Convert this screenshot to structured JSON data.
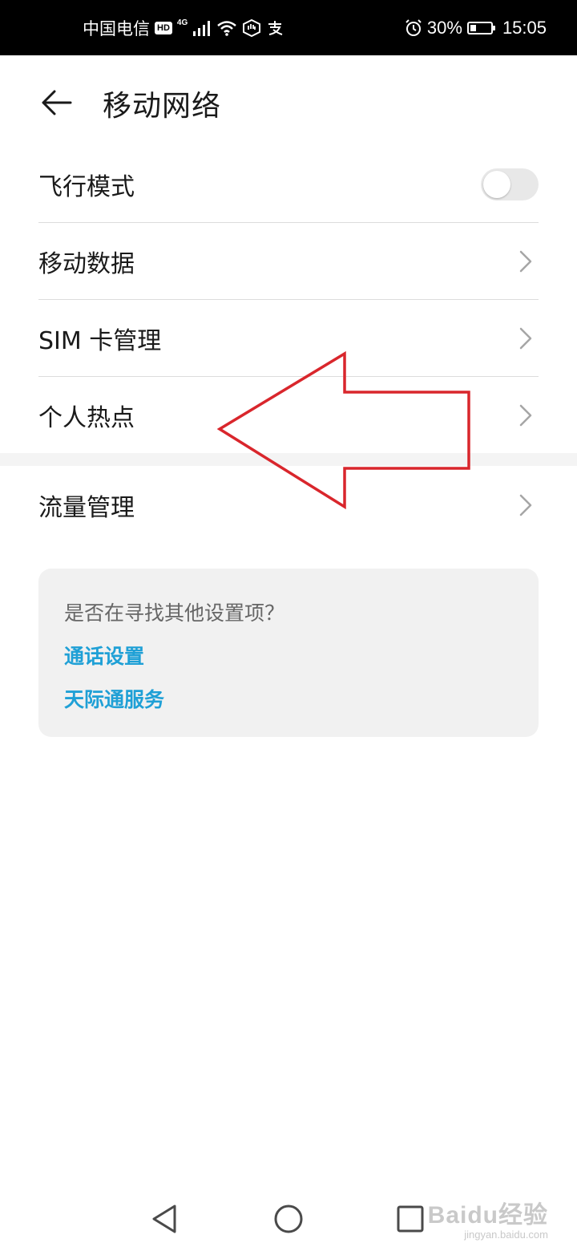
{
  "status_bar": {
    "carrier": "中国电信",
    "hd_badge": "HD",
    "network": "4G",
    "battery_percent": "30%",
    "battery_level": 0.3,
    "time": "15:05",
    "icons": [
      "hd-icon",
      "signal-icon",
      "wifi-icon",
      "hand-icon",
      "alipay-icon",
      "alarm-icon",
      "battery-icon"
    ]
  },
  "header": {
    "back_icon": "arrow-left-icon",
    "title": "移动网络"
  },
  "settings": {
    "items": [
      {
        "label": "飞行模式",
        "control": "toggle",
        "toggle_on": false
      },
      {
        "label": "移动数据",
        "control": "chevron"
      },
      {
        "label": "SIM 卡管理",
        "control": "chevron"
      },
      {
        "label": "个人热点",
        "control": "chevron"
      },
      {
        "label": "流量管理",
        "control": "chevron"
      }
    ]
  },
  "suggestions": {
    "title": "是否在寻找其他设置项？",
    "links": [
      "通话设置",
      "天际通服务"
    ]
  },
  "annotation": {
    "type": "arrow",
    "color": "#d9262c",
    "points_to": "个人热点"
  },
  "nav_bar": {
    "icons": [
      "back-triangle-icon",
      "home-circle-icon",
      "recents-square-icon"
    ]
  },
  "watermark": {
    "main": "Baidu经验",
    "sub": "jingyan.baidu.com"
  },
  "colors": {
    "link": "#1fa0d6",
    "divider": "#dcdcdc",
    "card_bg": "#f1f1f1"
  }
}
